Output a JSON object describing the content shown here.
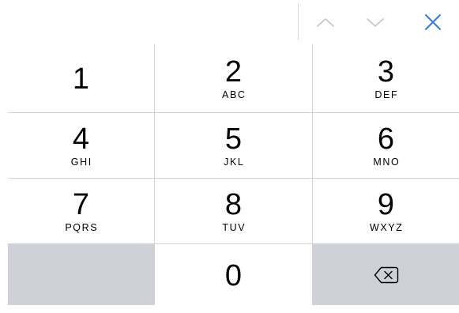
{
  "toolbar": {
    "prev_icon": "chevron-up-icon",
    "next_icon": "chevron-down-icon",
    "done_icon": "close-icon",
    "accent_color": "#3478f6",
    "disabled_color": "#c4c4c8"
  },
  "keypad": {
    "key_background": "#ffffff",
    "dark_key_background": "#cfd1d8",
    "keys": [
      {
        "digit": "1",
        "letters": ""
      },
      {
        "digit": "2",
        "letters": "ABC"
      },
      {
        "digit": "3",
        "letters": "DEF"
      },
      {
        "digit": "4",
        "letters": "GHI"
      },
      {
        "digit": "5",
        "letters": "JKL"
      },
      {
        "digit": "6",
        "letters": "MNO"
      },
      {
        "digit": "7",
        "letters": "PQRS"
      },
      {
        "digit": "8",
        "letters": "TUV"
      },
      {
        "digit": "9",
        "letters": "WXYZ"
      },
      {
        "digit": "0",
        "letters": ""
      }
    ],
    "delete_icon": "backspace-icon"
  }
}
